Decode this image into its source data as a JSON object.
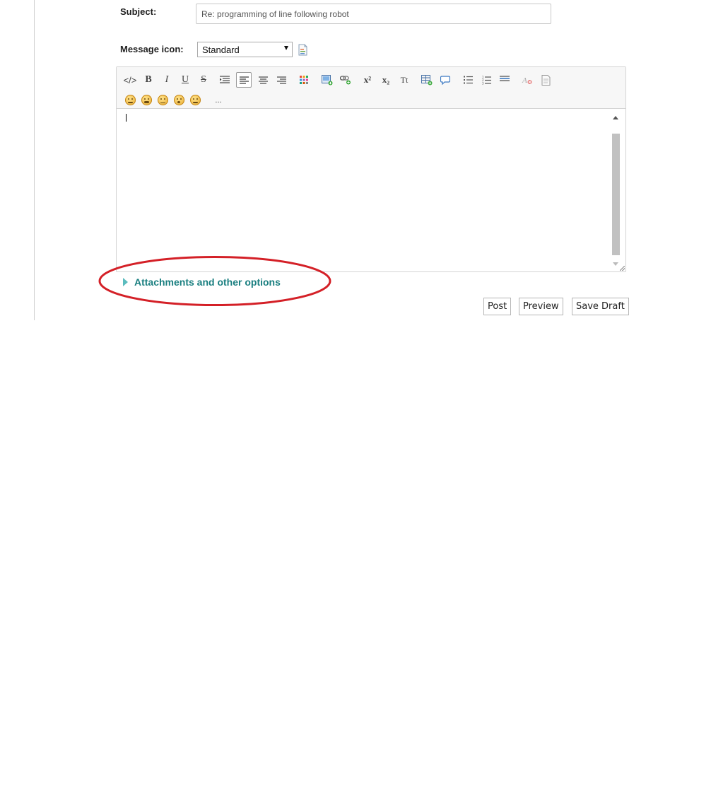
{
  "form": {
    "subject_label": "Subject:",
    "subject_value": "Re: programming of line following robot",
    "message_icon_label": "Message icon:",
    "message_icon_selected": "Standard"
  },
  "toolbar": {
    "row1": [
      {
        "name": "source-code-icon",
        "glyph": "</>"
      },
      {
        "name": "bold-icon",
        "glyph": "B"
      },
      {
        "name": "italic-icon",
        "glyph": "I"
      },
      {
        "name": "underline-icon",
        "glyph": "U"
      },
      {
        "name": "strikethrough-icon",
        "glyph": "S"
      },
      {
        "name": "indent-icon",
        "glyph": ""
      },
      {
        "name": "align-left-icon",
        "glyph": ""
      },
      {
        "name": "align-center-icon",
        "glyph": ""
      },
      {
        "name": "align-right-icon",
        "glyph": ""
      },
      {
        "name": "color-palette-icon",
        "glyph": ""
      },
      {
        "name": "insert-image-icon",
        "glyph": ""
      },
      {
        "name": "insert-link-icon",
        "glyph": ""
      },
      {
        "name": "superscript-icon",
        "glyph": "x²"
      },
      {
        "name": "subscript-icon",
        "glyph": "x₂"
      },
      {
        "name": "font-size-icon",
        "glyph": "Tt"
      },
      {
        "name": "insert-table-icon",
        "glyph": ""
      },
      {
        "name": "quote-icon",
        "glyph": ""
      },
      {
        "name": "bulleted-list-icon",
        "glyph": ""
      },
      {
        "name": "numbered-list-icon",
        "glyph": ""
      },
      {
        "name": "horizontal-rule-icon",
        "glyph": ""
      },
      {
        "name": "remove-format-icon",
        "glyph": ""
      },
      {
        "name": "paste-as-text-icon",
        "glyph": ""
      }
    ],
    "more_label": "..."
  },
  "attachments_label": "Attachments and other options",
  "buttons": {
    "post": "Post",
    "preview": "Preview",
    "save_draft": "Save Draft"
  },
  "colors": {
    "link_teal": "#1a7f80",
    "annotation_red": "#d42027"
  }
}
